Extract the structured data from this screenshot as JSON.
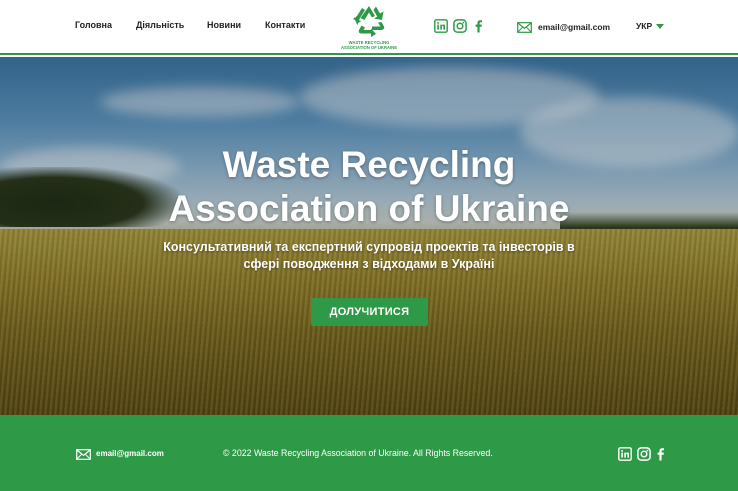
{
  "header": {
    "nav": [
      {
        "label": "Головна"
      },
      {
        "label": "Діяльність"
      },
      {
        "label": "Новини"
      },
      {
        "label": "Контакти"
      }
    ],
    "logo": {
      "line1": "WASTE RECYCLING",
      "line2": "ASSOCIATION OF UKRAINE",
      "icon": "recycle-icon"
    },
    "social_icons": [
      "linkedin-icon",
      "instagram-icon",
      "facebook-icon"
    ],
    "email": "email@gmail.com",
    "language": "УКР"
  },
  "hero": {
    "title_line1": "Waste Recycling",
    "title_line2": "Association of Ukraine",
    "subtitle_line1": "Консультативний та експертний супровід проектів та інвесторів в",
    "subtitle_line2": "сфері поводження з відходами в Україні",
    "cta_label": "ДОЛУЧИТИСЯ"
  },
  "footer": {
    "email": "email@gmail.com",
    "copyright": "© 2022 Waste Recycling Association of Ukraine. All Rights Reserved.",
    "social_icons": [
      "linkedin-icon",
      "instagram-icon",
      "facebook-icon"
    ]
  },
  "colors": {
    "brand_green": "#2e9a48",
    "text_dark": "#222222",
    "white": "#ffffff"
  }
}
